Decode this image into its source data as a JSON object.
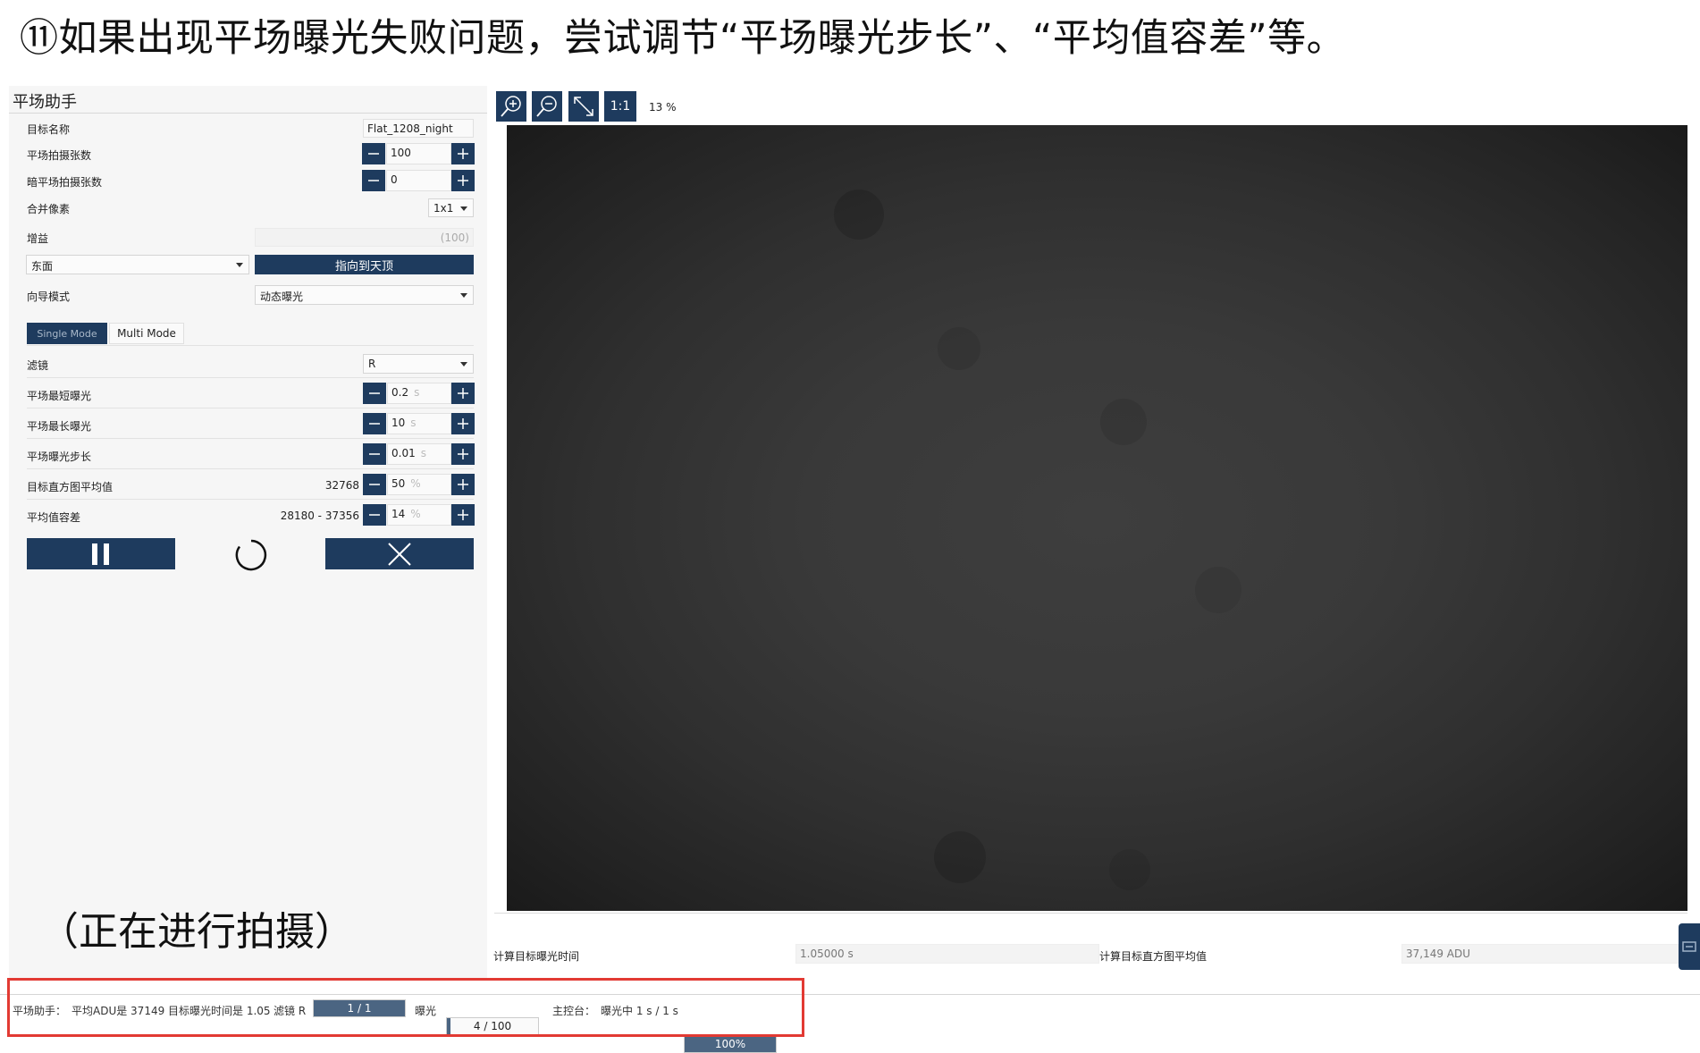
{
  "headline": "⑪如果出现平场曝光失败问题，尝试调节“平场曝光步长”、“平均值容差”等。",
  "caption": "（正在进行拍摄）",
  "panel": {
    "title": "平场助手",
    "target_name_label": "目标名称",
    "target_name_value": "Flat_1208_night",
    "flat_count_label": "平场拍摄张数",
    "flat_count_value": "100",
    "dark_count_label": "暗平场拍摄张数",
    "dark_count_value": "0",
    "binning_label": "合并像素",
    "binning_value": "1x1",
    "gain_label": "增益",
    "gain_placeholder": "(100)",
    "direction_value": "东面",
    "point_zenith_label": "指向到天顶",
    "wizard_mode_label": "向导模式",
    "wizard_mode_value": "动态曝光",
    "tabs": [
      "Single Mode",
      "Multi Mode"
    ],
    "filter_label": "滤镜",
    "filter_value": "R",
    "min_exposure_label": "平场最短曝光",
    "min_exposure_value": "0.2",
    "min_exposure_unit": "s",
    "max_exposure_label": "平场最长曝光",
    "max_exposure_value": "10",
    "max_exposure_unit": "s",
    "step_label": "平场曝光步长",
    "step_value": "0.01",
    "step_unit": "s",
    "histogram_label": "目标直方图平均值",
    "histogram_adu": "32768",
    "histogram_value": "50",
    "histogram_unit": "%",
    "tolerance_label": "平均值容差",
    "tolerance_range": "28180 - 37356",
    "tolerance_value": "14",
    "tolerance_unit": "%"
  },
  "toolbar": {
    "zoom_in_icon": "zoom-in-icon",
    "zoom_out_icon": "zoom-out-icon",
    "fit_icon": "fit-to-screen-icon",
    "one_to_one_label": "1:1",
    "zoom_level": "13 %"
  },
  "image_info": {
    "calc_exposure_label": "计算目标曝光时间",
    "calc_exposure_value": "1.05000 s",
    "calc_histogram_label": "计算目标直方图平均值",
    "calc_histogram_value": "37,149 ADU"
  },
  "status_bar": {
    "prefix": "平场助手：",
    "message": "平均ADU是 37149 目标曝光时间是 1.05",
    "filter_text": "滤镜 R",
    "filter_progress": "1 / 1",
    "filter_progress_fraction": 1.0,
    "exposure_label": "曝光",
    "exposure_progress": "4 / 100",
    "exposure_progress_fraction": 0.04,
    "main_label": "主控台：",
    "main_status": "曝光中 1 s / 1 s",
    "main_progress": "100%",
    "main_progress_fraction": 1.0
  },
  "colors": {
    "accent": "#1e3b5e",
    "highlight_box": "#e23a33",
    "progress_fill": "#4b6582"
  }
}
